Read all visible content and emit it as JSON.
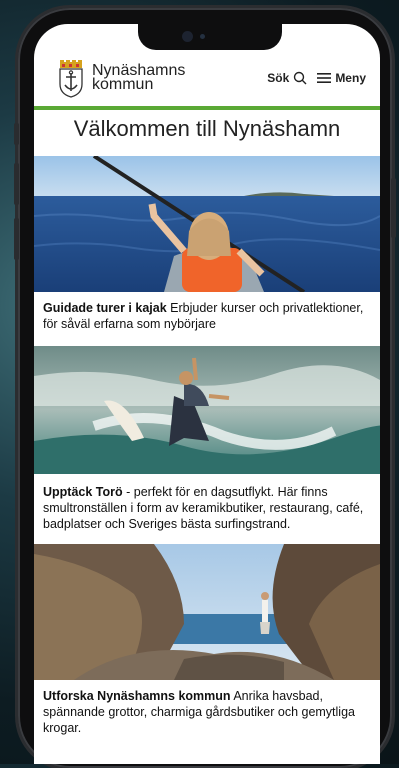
{
  "header": {
    "logo_line1": "Nynäshamns",
    "logo_line2": "kommun",
    "search_label": "Sök",
    "menu_label": "Meny"
  },
  "page": {
    "title": "Välkommen till Nynäshamn"
  },
  "cards": [
    {
      "heading": "Guidade turer i kajak",
      "text": " Erbjuder kurser och privatlektioner, för såväl erfarna som nybörjare"
    },
    {
      "heading": "Upptäck Torö",
      "text": " - perfekt för en dagsutflykt. Här finns smultronställen i form av keramikbutiker, restaurang, café, badplatser och Sveriges bästa surfingstrand."
    },
    {
      "heading": "Utforska Nynäshamns kommun",
      "text": " Anrika havsbad, spännande grottor, charmiga gårdsbutiker och gemytliga krogar."
    }
  ],
  "colors": {
    "accent_green": "#5aa935"
  }
}
